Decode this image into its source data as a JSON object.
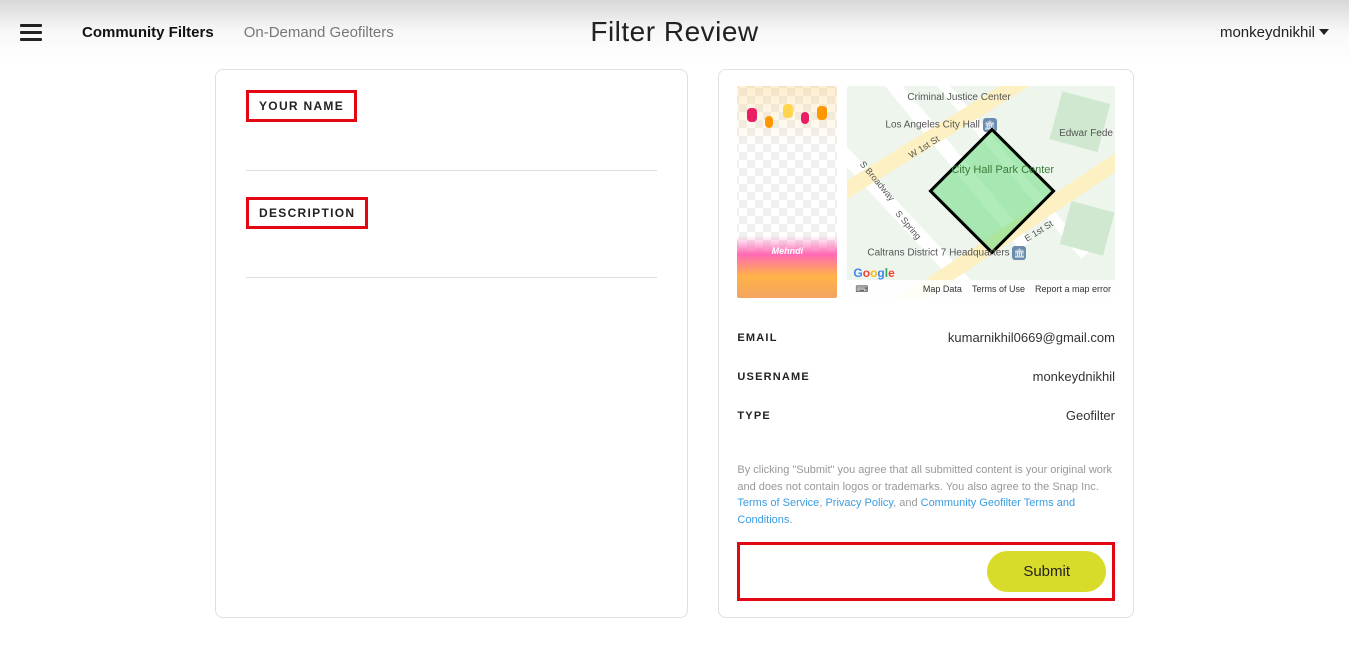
{
  "header": {
    "title": "Filter Review",
    "tabs": {
      "community": "Community Filters",
      "ondemand": "On-Demand Geofilters"
    },
    "user": "monkeydnikhil"
  },
  "form": {
    "name_label": "YOUR NAME",
    "desc_label": "DESCRIPTION"
  },
  "preview": {
    "filter_text": "Mehndi"
  },
  "map": {
    "poi_criminal": "Criminal Justice Center",
    "poi_cityhall": "Los Angeles City Hall",
    "poi_edwards": "Edwar\nFede",
    "poi_caltrans": "Caltrans District\n7 Headquarters",
    "geofence_label": "City Hall\nPark Center",
    "street_broadway": "S Broadway",
    "street_spring": "S Spring",
    "street_w1st": "W 1st St",
    "street_e1st": "E 1st St",
    "footer": {
      "mapdata": "Map Data",
      "terms": "Terms of Use",
      "report": "Report a map error"
    }
  },
  "info": {
    "email_label": "EMAIL",
    "email_value": "kumarnikhil0669@gmail.com",
    "username_label": "USERNAME",
    "username_value": "monkeydnikhil",
    "type_label": "TYPE",
    "type_value": "Geofilter"
  },
  "legal": {
    "prefix": "By clicking \"Submit\" you agree that all submitted content is your original work and does not contain logos or trademarks. You also agree to the Snap Inc. ",
    "tos": "Terms of Service",
    "sep1": ", ",
    "privacy": "Privacy Policy",
    "sep2": ", and ",
    "community_terms": "Community Geofilter Terms and Conditions",
    "suffix": "."
  },
  "submit_label": "Submit"
}
